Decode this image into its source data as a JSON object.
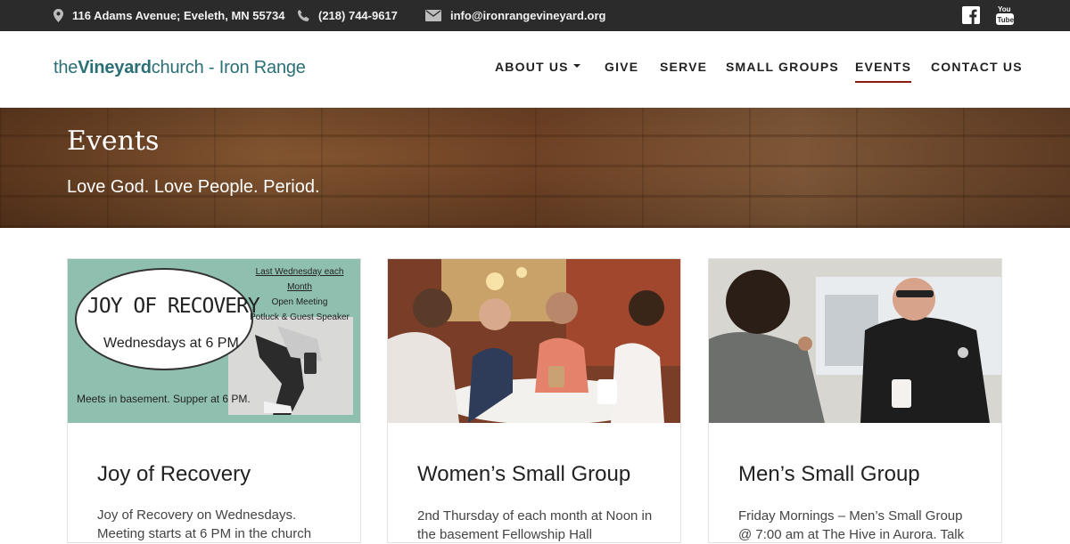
{
  "topbar": {
    "address": "116 Adams Avenue; Eveleth, MN 55734",
    "phone": "(218) 744-9617",
    "email": "info@ironrangevineyard.org",
    "social": [
      "facebook-icon",
      "youtube-icon"
    ]
  },
  "header": {
    "logo": {
      "the": "the",
      "vineyard": "Vineyard",
      "church": "church",
      "sep": " - ",
      "place": "Iron Range"
    },
    "nav": [
      {
        "label": "ABOUT US",
        "dropdown": true
      },
      {
        "label": "GIVE"
      },
      {
        "label": "SERVE"
      },
      {
        "label": "SMALL GROUPS"
      },
      {
        "label": "EVENTS",
        "active": true
      },
      {
        "label": "CONTACT US"
      }
    ]
  },
  "hero": {
    "title": "Events",
    "subtitle": "Love God. Love People. Period."
  },
  "cards": [
    {
      "title": "Joy of Recovery",
      "text": "Joy of Recovery on Wednesdays. Meeting starts at 6 PM in the church",
      "flyer": {
        "head": "JOY OF RECOVERY",
        "when": "Wednesdays at 6 PM",
        "top_right_line1": "Last Wednesday each Month",
        "top_right_line2": "Open Meeting",
        "top_right_line3": "Potluck & Guest Speaker",
        "bottom": "Meets in basement. Supper at 6 PM."
      }
    },
    {
      "title": "Women’s Small Group",
      "text": "2nd Thursday of each month at Noon in the basement Fellowship Hall"
    },
    {
      "title": "Men’s Small Group",
      "text": "Friday Mornings – Men’s Small Group @ 7:00 am at The Hive in Aurora. Talk"
    }
  ],
  "colors": {
    "topbar_bg": "#2b2b2b",
    "logo": "#2a6f74",
    "nav_active_underline": "#8b1a10",
    "flyer_bg": "#8fbfae"
  }
}
